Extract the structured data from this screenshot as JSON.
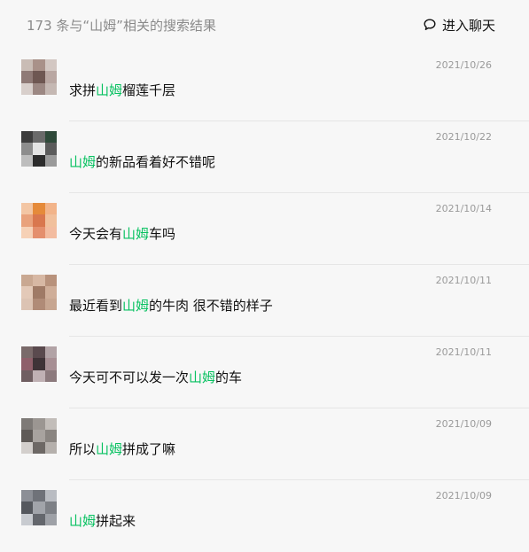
{
  "header": {
    "result_count": "173 条与“山姆”相关的搜索结果",
    "enter_chat_label": "进入聊天",
    "icon": "chat-bubble-icon"
  },
  "highlight_color": "#07c160",
  "messages": [
    {
      "date": "2021/10/26",
      "before": "求拼",
      "keyword": "山姆",
      "after": "榴莲千层",
      "avatar": [
        "#c9bcb5",
        "#a99189",
        "#d3c7c2",
        "#8f7a76",
        "#6e5752",
        "#b9a7a2",
        "#d8cfcb",
        "#9c8883",
        "#c5b8b3"
      ]
    },
    {
      "date": "2021/10/22",
      "before": "",
      "keyword": "山姆",
      "after": "的新品看着好不错呢",
      "avatar": [
        "#3d3d3d",
        "#6a6a6a",
        "#2f4a3a",
        "#8d8d8d",
        "#e4e4e4",
        "#5b5b5b",
        "#bdbdbd",
        "#2c2c2c",
        "#9a9a9a"
      ]
    },
    {
      "date": "2021/10/14",
      "before": "今天会有",
      "keyword": "山姆",
      "after": "车吗",
      "avatar": [
        "#f3c6a4",
        "#e58a3a",
        "#f2b48a",
        "#e9a27c",
        "#d9774e",
        "#f1c09c",
        "#f6d1b6",
        "#e48f6d",
        "#f3bca0"
      ]
    },
    {
      "date": "2021/10/11",
      "before": "最近看到",
      "keyword": "山姆",
      "after": "的牛肉 很不错的样子",
      "avatar": [
        "#c9a892",
        "#d7b8a4",
        "#b8927c",
        "#e3c9b8",
        "#9f7a66",
        "#cfae99",
        "#dcc3b3",
        "#b08b77",
        "#c7a691"
      ]
    },
    {
      "date": "2021/10/11",
      "before": "今天可不可以发一次",
      "keyword": "山姆",
      "after": "的车",
      "avatar": [
        "#7a6a6a",
        "#5a4a4e",
        "#b2a3a6",
        "#8f5f6a",
        "#3f3337",
        "#a78f94",
        "#6f5e61",
        "#c0b1b4",
        "#8c7a7d"
      ]
    },
    {
      "date": "2021/10/09",
      "before": "所以",
      "keyword": "山姆",
      "after": "拼成了嘛",
      "avatar": [
        "#7e7a77",
        "#9b9692",
        "#c2bdb9",
        "#5f5a57",
        "#a8a39f",
        "#8a8581",
        "#d3cfcc",
        "#6d6865",
        "#b5b0ac"
      ]
    },
    {
      "date": "2021/10/09",
      "before": "",
      "keyword": "山姆",
      "after": "拼起来",
      "avatar": [
        "#8c8f96",
        "#6f7279",
        "#b9bcc2",
        "#55585e",
        "#a1a4aa",
        "#7d8086",
        "#c8cbd0",
        "#64676d",
        "#9ea1a7"
      ]
    }
  ]
}
